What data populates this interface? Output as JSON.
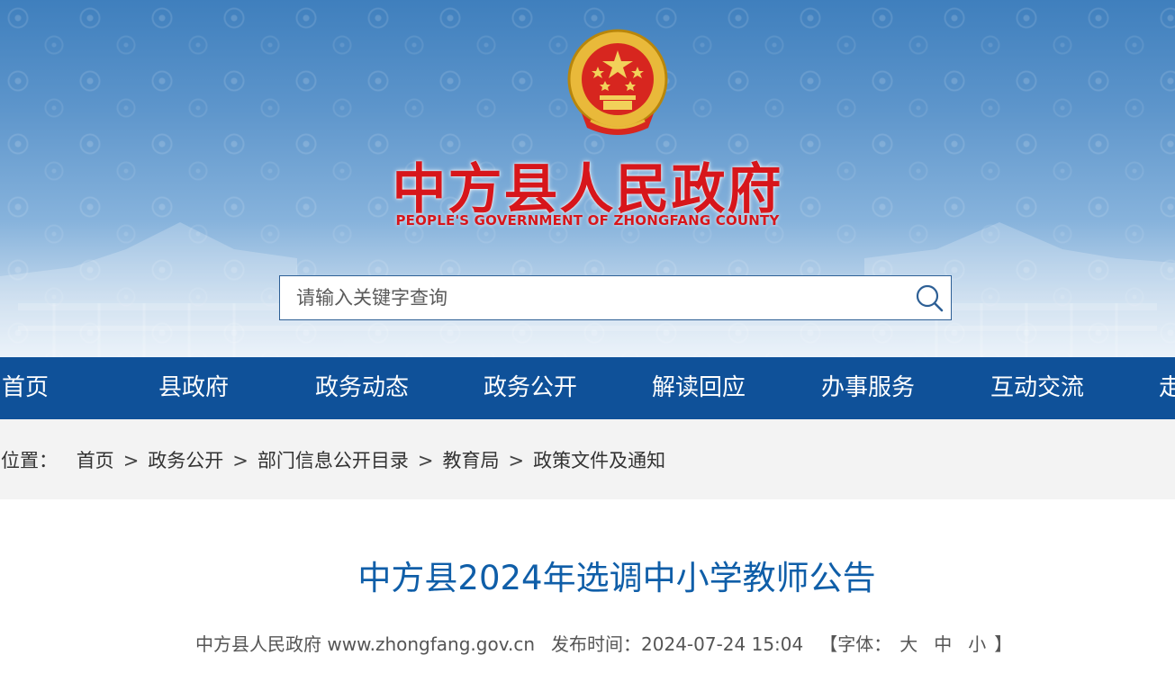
{
  "header": {
    "title": "中方县人民政府",
    "subtitle": "PEOPLE'S GOVERNMENT OF ZHONGFANG COUNTY",
    "emblem_icon": "national-emblem-icon",
    "colors": {
      "title": "#d7161b",
      "banner_blue": "#3f7fbd"
    }
  },
  "search": {
    "placeholder": "请输入关键字查询",
    "value": "",
    "button_icon": "search-icon"
  },
  "nav": {
    "background": "#0f5199",
    "items": [
      {
        "label": "首页"
      },
      {
        "label": "县政府"
      },
      {
        "label": "政务动态"
      },
      {
        "label": "政务公开"
      },
      {
        "label": "解读回应"
      },
      {
        "label": "办事服务"
      },
      {
        "label": "互动交流"
      },
      {
        "label": "走"
      }
    ]
  },
  "breadcrumb": {
    "prefix": "的位置：",
    "separator": ">",
    "items": [
      "首页",
      "政务公开",
      "部门信息公开目录",
      "教育局",
      "政策文件及通知"
    ]
  },
  "article": {
    "title": "中方县2024年选调中小学教师公告",
    "title_color": "#0f5ea8",
    "source": "中方县人民政府 www.zhongfang.gov.cn",
    "publish_label": "发布时间：",
    "publish_time": "2024-07-24 15:04",
    "font_size_open": "【字体：",
    "font_large": "大",
    "font_medium": "中",
    "font_small": "小",
    "font_size_close": "】"
  }
}
